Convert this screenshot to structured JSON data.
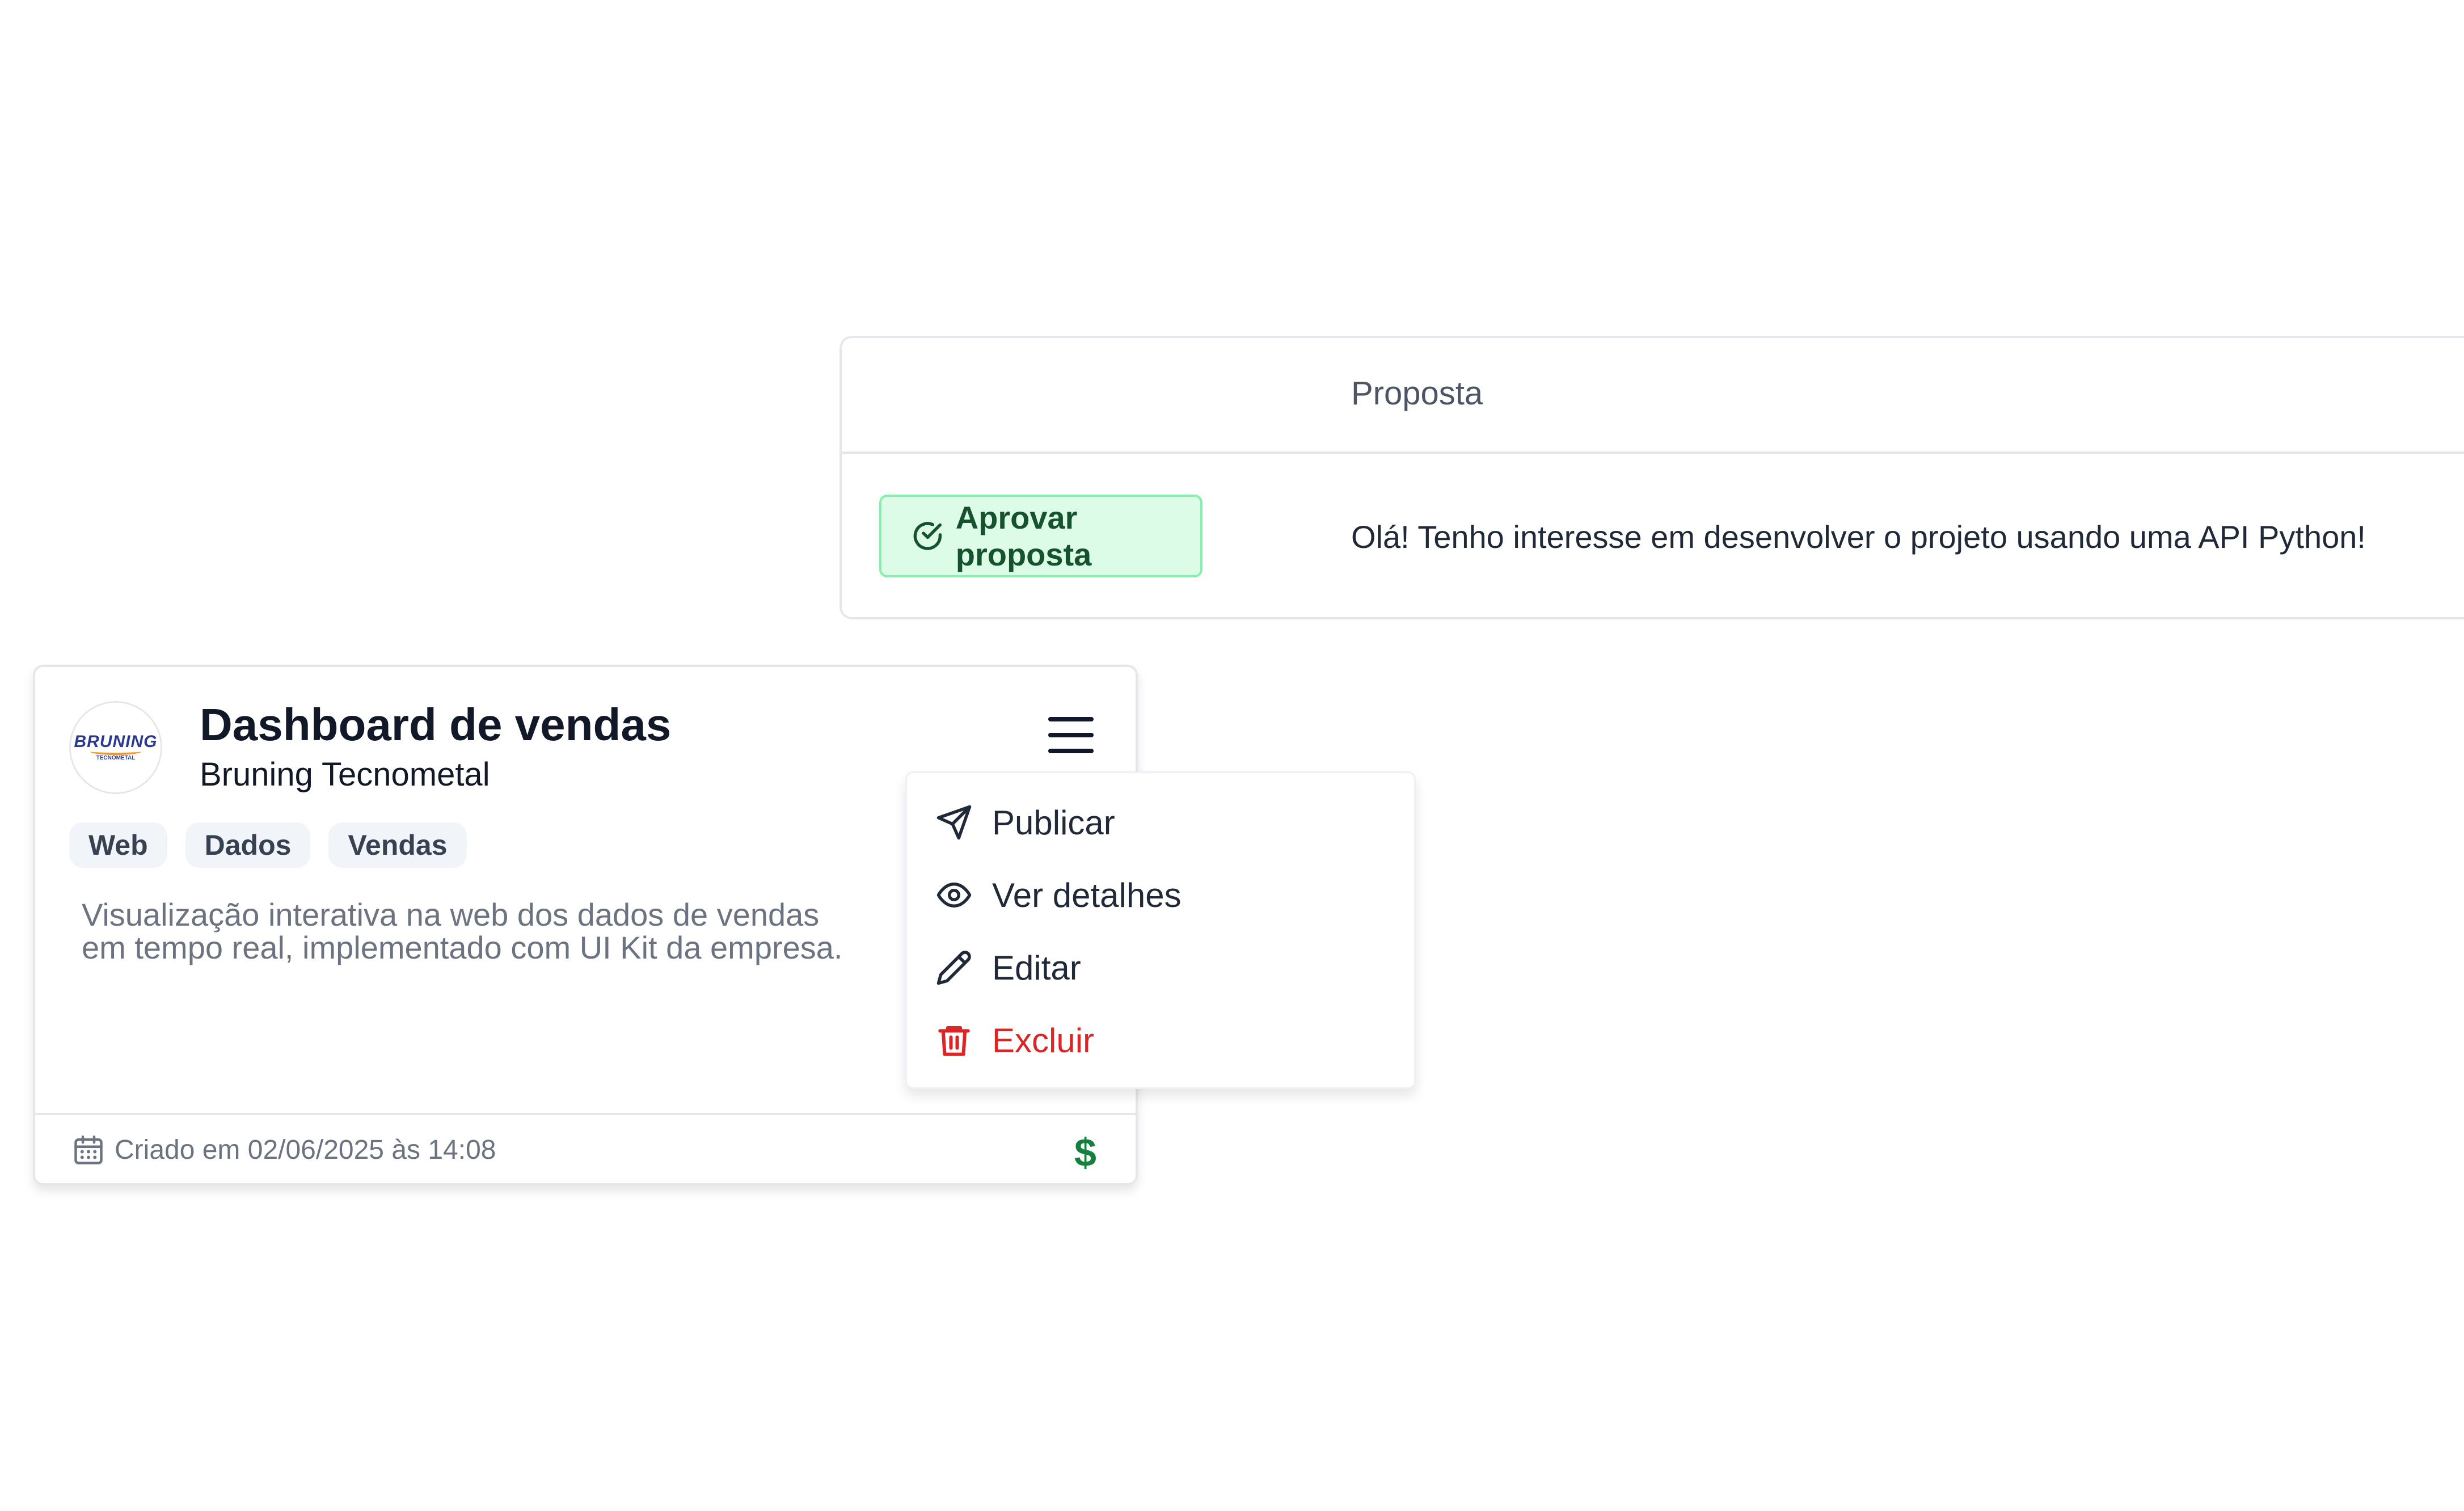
{
  "proposals": {
    "column_title": "Proposta",
    "rows": [
      {
        "action_label": "Aprovar proposta",
        "message": "Olá! Tenho interesse em desenvolver o projeto usando uma API Python!"
      }
    ]
  },
  "card": {
    "logo_text": "BRUNING",
    "logo_subtext": "TECNOMETAL",
    "title": "Dashboard de vendas",
    "company": "Bruning Tecnometal",
    "tags": [
      "Web",
      "Dados",
      "Vendas"
    ],
    "description_lines": [
      "Visualização interativa na web dos dados de vendas",
      "em tempo real, implementado com UI Kit da empresa."
    ],
    "created_text": "Criado em 02/06/2025 às 14:08",
    "price_icon": "$"
  },
  "menu": {
    "items": [
      {
        "label": "Publicar",
        "icon": "send-icon"
      },
      {
        "label": "Ver detalhes",
        "icon": "eye-icon"
      },
      {
        "label": "Editar",
        "icon": "pencil-icon"
      },
      {
        "label": "Excluir",
        "icon": "trash-icon"
      }
    ]
  },
  "colors": {
    "approve_bg": "#dcfce7",
    "approve_border": "#86efac",
    "danger": "#dc2626",
    "money": "#15803d"
  }
}
